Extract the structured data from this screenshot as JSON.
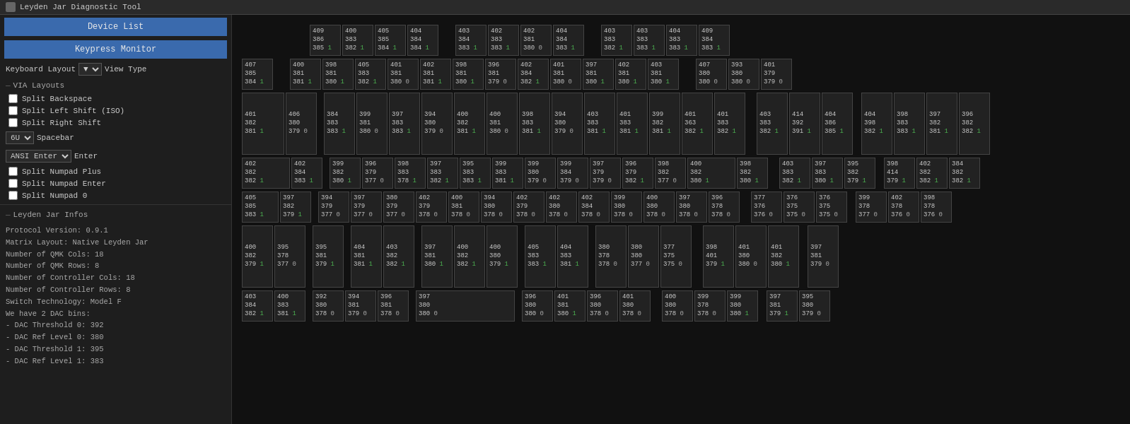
{
  "titlebar": {
    "title": "Leyden Jar Diagnostic Tool"
  },
  "sidebar": {
    "device_list_label": "Device List",
    "keypress_monitor_label": "Keypress Monitor",
    "keyboard_layout_label": "Keyboard Layout",
    "view_type_label": "View Type",
    "via_layouts_label": "VIA Layouts",
    "split_backspace_label": "Split Backspace",
    "split_left_shift_label": "Split Left Shift (ISO)",
    "split_right_shift_label": "Split Right Shift",
    "spacebar_label": "Spacebar",
    "spacebar_value": "6U",
    "enter_label": "Enter",
    "enter_value": "ANSI Enter",
    "split_numpad_plus_label": "Split Numpad Plus",
    "split_numpad_enter_label": "Split Numpad Enter",
    "split_numpad_0_label": "Split Numpad 0",
    "leyden_jar_infos_label": "Leyden Jar Infos",
    "info_lines": [
      "Protocol Version: 0.9.1",
      "Matrix Layout: Native Leyden Jar",
      "Number of QMK Cols: 18",
      "Number of QMK Rows: 8",
      "Number of Controller Cols: 18",
      "Number of Controller Rows: 8",
      "Switch Technology: Model F",
      "We have 2 DAC bins:",
      "  - DAC Threshold 0: 392",
      "  - DAC Ref Level 0: 380",
      "  - DAC Threshold 1: 395",
      "  - DAC Ref Level 1: 383"
    ]
  },
  "keyboard": {
    "rows": [
      [
        {
          "vals": [
            "409",
            "386",
            "385"
          ],
          "flag": "1"
        },
        {
          "vals": [
            "400",
            "383",
            "382"
          ],
          "flag": "1"
        },
        {
          "vals": [
            "405",
            "385",
            "384"
          ],
          "flag": "1"
        },
        {
          "vals": [
            "404",
            "384",
            "384"
          ],
          "flag": "1"
        },
        null,
        {
          "vals": [
            "403",
            "384",
            "383"
          ],
          "flag": "1"
        },
        {
          "vals": [
            "402",
            "383",
            "383"
          ],
          "flag": "1"
        },
        {
          "vals": [
            "402",
            "381",
            "380"
          ],
          "flag": "0"
        },
        {
          "vals": [
            "404",
            "384",
            "383"
          ],
          "flag": "1"
        },
        null,
        {
          "vals": [
            "403",
            "383",
            "382"
          ],
          "flag": "1"
        },
        {
          "vals": [
            "403",
            "383",
            "383"
          ],
          "flag": "1"
        },
        {
          "vals": [
            "404",
            "383",
            "383"
          ],
          "flag": "1"
        },
        {
          "vals": [
            "409",
            "384",
            "383"
          ],
          "flag": "1"
        }
      ],
      [
        {
          "vals": [
            "407",
            "385",
            "384"
          ],
          "flag": "1"
        },
        null,
        {
          "vals": [
            "400",
            "381",
            "381"
          ],
          "flag": "1"
        },
        {
          "vals": [
            "398",
            "381",
            "380"
          ],
          "flag": "1"
        },
        {
          "vals": [
            "405",
            "383",
            "382"
          ],
          "flag": "1"
        },
        {
          "vals": [
            "401",
            "381",
            "380"
          ],
          "flag": "0"
        },
        null,
        {
          "vals": [
            "402",
            "381",
            "381"
          ],
          "flag": "1"
        },
        {
          "vals": [
            "398",
            "381",
            "380"
          ],
          "flag": "1"
        },
        {
          "vals": [
            "396",
            "381",
            "379"
          ],
          "flag": "0"
        },
        {
          "vals": [
            "402",
            "384",
            "382"
          ],
          "flag": "1"
        },
        null,
        {
          "vals": [
            "401",
            "381",
            "380"
          ],
          "flag": "0"
        },
        {
          "vals": [
            "397",
            "381",
            "380"
          ],
          "flag": "1"
        },
        {
          "vals": [
            "402",
            "381",
            "380"
          ],
          "flag": "1"
        },
        {
          "vals": [
            "403",
            "381",
            "380"
          ],
          "flag": "1"
        },
        null,
        {
          "vals": [
            "407",
            "380",
            "380"
          ],
          "flag": "0"
        },
        {
          "vals": [
            "393",
            "380",
            "380"
          ],
          "flag": "0"
        },
        {
          "vals": [
            "401",
            "379",
            "379"
          ],
          "flag": "0"
        }
      ]
    ]
  }
}
